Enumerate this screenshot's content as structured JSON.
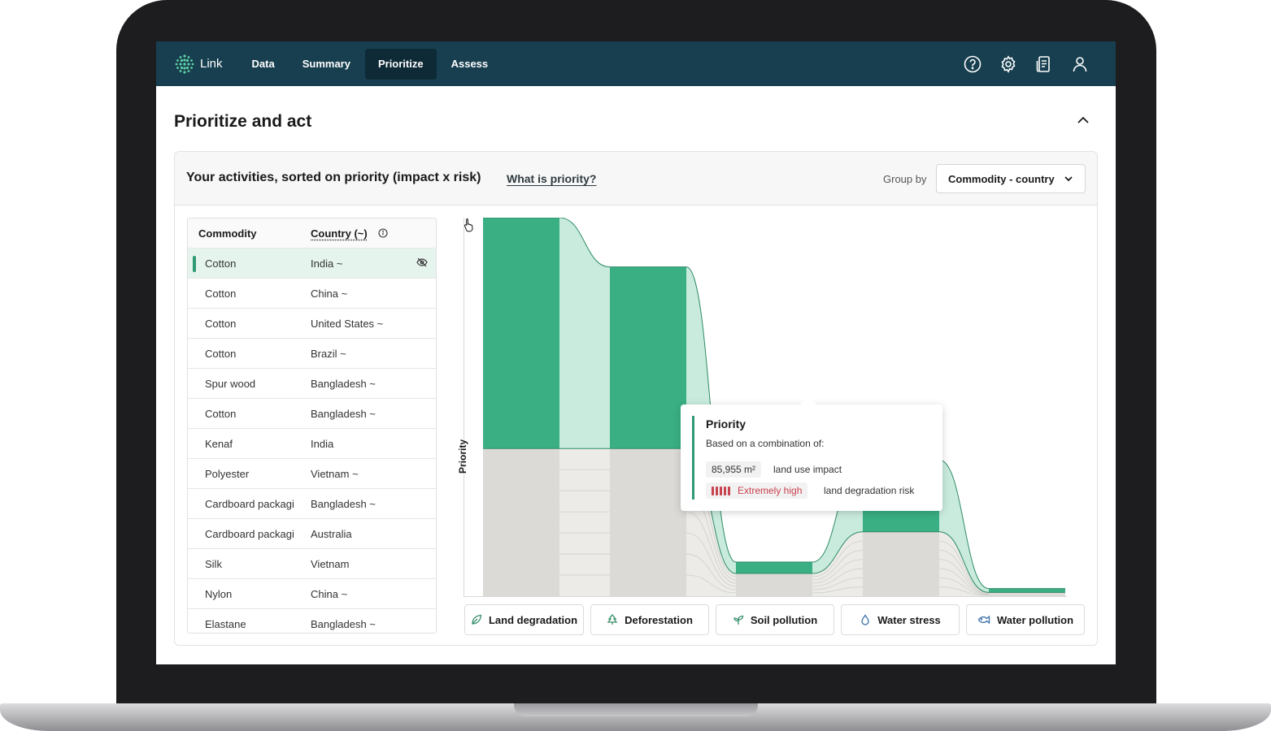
{
  "app": {
    "name": "Link"
  },
  "nav": {
    "items": [
      "Data",
      "Summary",
      "Prioritize",
      "Assess"
    ],
    "active": "Prioritize"
  },
  "page": {
    "title": "Prioritize and act"
  },
  "panel": {
    "title": "Your activities, sorted on priority (impact x risk)",
    "link": "What is priority?",
    "group_by_label": "Group by",
    "group_by_value": "Commodity - country"
  },
  "table": {
    "headers": {
      "commodity": "Commodity",
      "country": "Country (~)"
    },
    "rows": [
      {
        "commodity": "Cotton",
        "country": "India ~",
        "selected": true
      },
      {
        "commodity": "Cotton",
        "country": "China ~"
      },
      {
        "commodity": "Cotton",
        "country": "United States ~"
      },
      {
        "commodity": "Cotton",
        "country": "Brazil ~"
      },
      {
        "commodity": "Spur wood",
        "country": "Bangladesh ~"
      },
      {
        "commodity": "Cotton",
        "country": "Bangladesh ~"
      },
      {
        "commodity": "Kenaf",
        "country": "India"
      },
      {
        "commodity": "Polyester",
        "country": "Vietnam ~"
      },
      {
        "commodity": "Cardboard packagi",
        "country": "Bangladesh ~"
      },
      {
        "commodity": "Cardboard packagi",
        "country": "Australia"
      },
      {
        "commodity": "Silk",
        "country": "Vietnam"
      },
      {
        "commodity": "Nylon",
        "country": "China ~"
      },
      {
        "commodity": "Elastane",
        "country": "Bangladesh ~"
      }
    ]
  },
  "chart": {
    "y_label": "Priority"
  },
  "chart_data": {
    "type": "bar",
    "categories": [
      "Cotton · India ~",
      "Cotton · China ~",
      "Cotton · United States ~",
      "Cotton · Brazil ~",
      "Spur wood · Bangladesh ~"
    ],
    "series": [
      {
        "name": "",
        "values": [
          1.0,
          0.87,
          0.09,
          0.36,
          0.02
        ]
      },
      {
        "name": "",
        "values": [
          0.39,
          0.39,
          0.06,
          0.17,
          0.01
        ]
      }
    ],
    "ylabel": "Priority",
    "ylim": [
      0,
      1
    ],
    "colors": {
      "highlight": "#3aaf84",
      "band": "#c9ebdd",
      "base": "#dcdad6",
      "line": "#2e8b66"
    }
  },
  "tooltip": {
    "title": "Priority",
    "subtitle": "Based on a combination of:",
    "impact_value": "85,955 m²",
    "impact_label": "land use impact",
    "risk_value": "Extremely high",
    "risk_level": 5,
    "risk_label": "land degradation risk"
  },
  "filters": [
    {
      "label": "Land degradation",
      "icon": "leaf-icon"
    },
    {
      "label": "Deforestation",
      "icon": "tree-icon"
    },
    {
      "label": "Soil pollution",
      "icon": "sprout-icon"
    },
    {
      "label": "Water stress",
      "icon": "droplet-icon"
    },
    {
      "label": "Water pollution",
      "icon": "fish-icon"
    }
  ],
  "icons": {
    "top": [
      "help-icon",
      "settings-icon",
      "report-icon",
      "user-icon"
    ]
  }
}
